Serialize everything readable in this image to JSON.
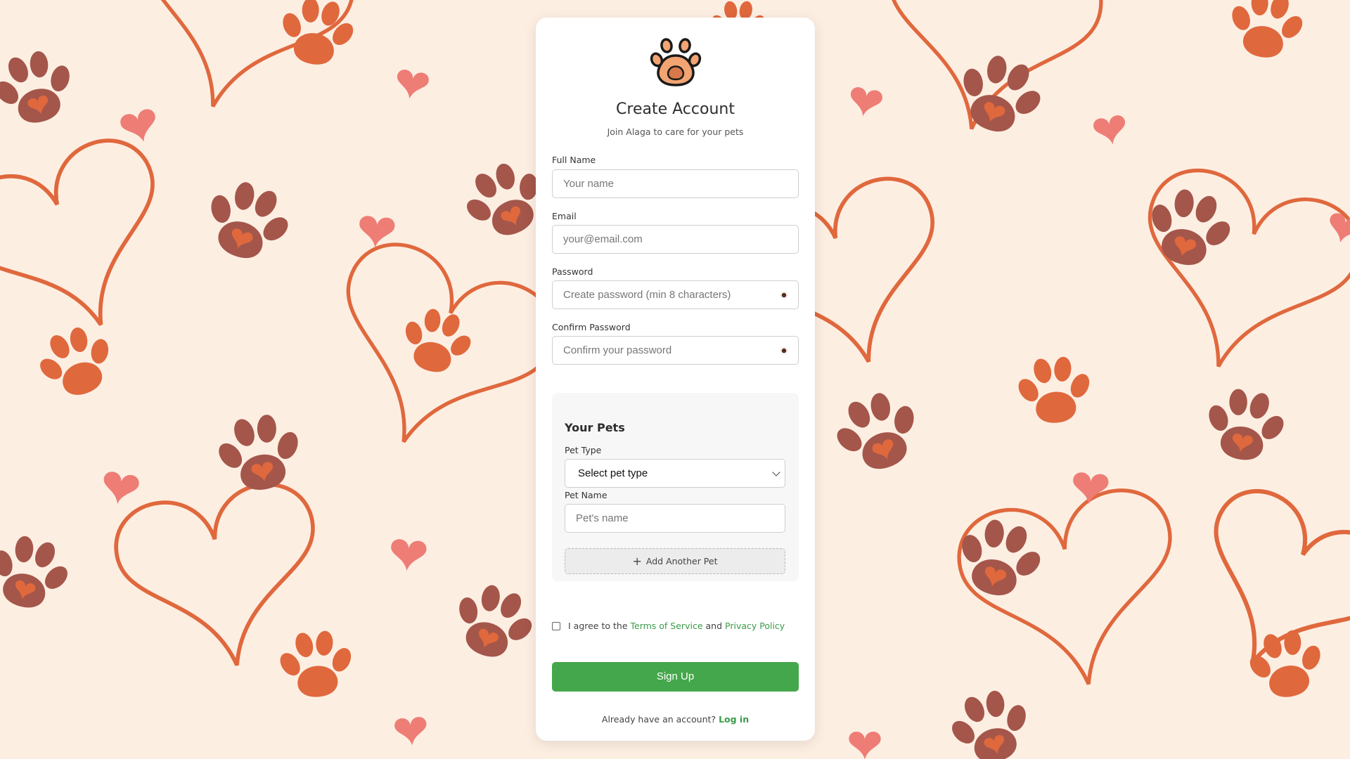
{
  "theme": {
    "background": "#fdeee2",
    "paw_dark": "#a4564a",
    "paw_orange": "#e0683d",
    "heart_pink": "#ee7d75",
    "primary_green": "#45a74b",
    "link_green": "#3b9b4a"
  },
  "header": {
    "logo_icon": "paw-icon",
    "title": "Create Account",
    "subtitle": "Join Alaga to care for your pets"
  },
  "form": {
    "full_name": {
      "label": "Full Name",
      "placeholder": "Your name",
      "value": ""
    },
    "email": {
      "label": "Email",
      "placeholder": "your@email.com",
      "value": ""
    },
    "password": {
      "label": "Password",
      "placeholder": "Create password (min 8 characters)",
      "value": "",
      "toggle_icon": "eye-icon"
    },
    "confirm_password": {
      "label": "Confirm Password",
      "placeholder": "Confirm your password",
      "value": "",
      "toggle_icon": "eye-icon"
    }
  },
  "pets": {
    "title": "Your Pets",
    "pet_type_label": "Pet Type",
    "pet_type_selected": "Select pet type",
    "pet_name_label": "Pet Name",
    "pet_name_placeholder": "Pet's name",
    "add_button": "Add Another Pet",
    "add_icon": "plus-icon"
  },
  "terms": {
    "prefix": "I agree to the",
    "tos": "Terms of Service",
    "and": "and",
    "privacy": "Privacy Policy",
    "checked": false
  },
  "signup_button": "Sign Up",
  "login": {
    "prompt": "Already have an account?",
    "link": "Log in"
  }
}
